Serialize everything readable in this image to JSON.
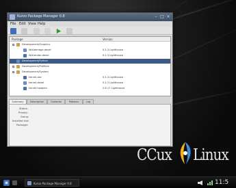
{
  "window": {
    "title": "Kuroo Package Manager 0.8",
    "menu": [
      "File",
      "Edit",
      "View",
      "Help"
    ],
    "toolbar_buttons": [
      "home-icon",
      "leaf-icon",
      "filter-icon",
      "refresh-icon",
      "play-icon",
      "wrench-icon"
    ]
  },
  "tree": {
    "columns": [
      "Package",
      "Version"
    ],
    "rows": [
      {
        "indent": 0,
        "kind": "group",
        "name": "Development/Graphics",
        "version": "",
        "selected": false
      },
      {
        "indent": 1,
        "kind": "item",
        "name": "libXdamage-devel",
        "version": "0.1.2 Lighthouse",
        "selected": false
      },
      {
        "indent": 1,
        "kind": "item",
        "name": "libXrender-devel",
        "version": "0.1.2 Lighthouse",
        "selected": false
      },
      {
        "indent": 0,
        "kind": "item",
        "name": "Development/Python",
        "version": "",
        "selected": true
      },
      {
        "indent": 0,
        "kind": "group",
        "name": "Development/Profilers",
        "version": "",
        "selected": false
      },
      {
        "indent": 0,
        "kind": "group",
        "name": "Development/System",
        "version": "",
        "selected": false
      },
      {
        "indent": 1,
        "kind": "item",
        "name": "kernel-doc",
        "version": "0.1.2 Lighthouse",
        "selected": false
      },
      {
        "indent": 1,
        "kind": "item",
        "name": "kernel-devel",
        "version": "0.1.2 Lighthouse",
        "selected": false
      },
      {
        "indent": 1,
        "kind": "item",
        "name": "kernel-headers",
        "version": "2.6.17 Lighthouse",
        "selected": false
      }
    ]
  },
  "detail_tabs": [
    "Summary",
    "Description",
    "Contents",
    "Patterns",
    "Log"
  ],
  "details": [
    "Status:",
    "Priority:",
    "Group:",
    "Installed size:",
    "Packager:"
  ],
  "logo": {
    "left": "CCux",
    "right": "Linux"
  },
  "taskbar": {
    "task_label": "Kuroo Package Manager 0.8",
    "clock": "11:5"
  }
}
